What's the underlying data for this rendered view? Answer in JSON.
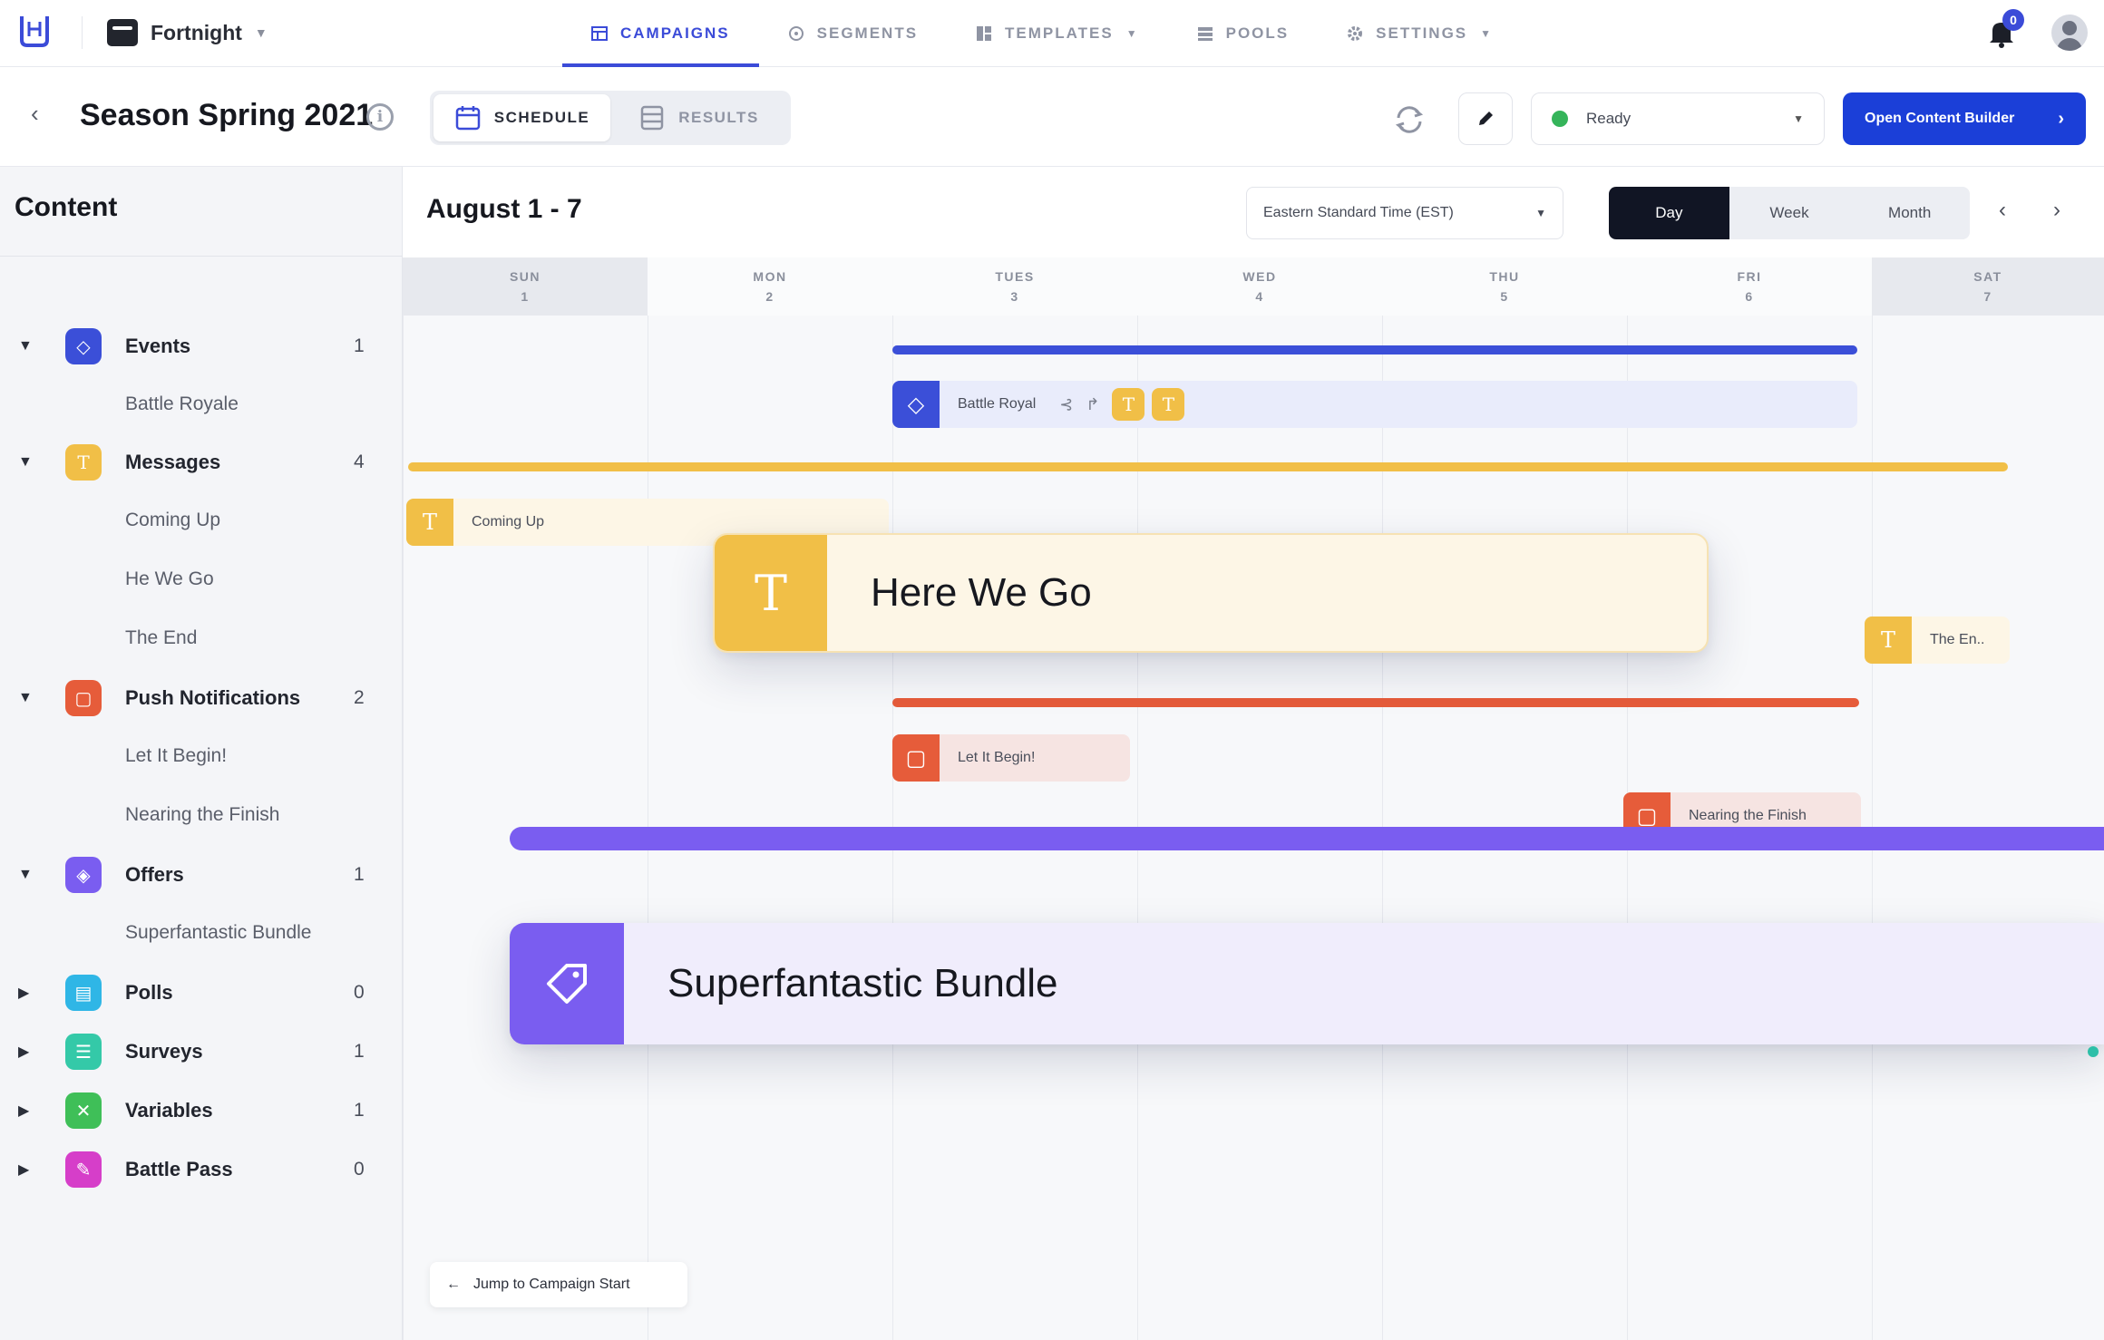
{
  "nav": {
    "project": "Fortnight",
    "tabs": [
      {
        "label": "CAMPAIGNS",
        "icon": "calendar-grid-icon"
      },
      {
        "label": "SEGMENTS",
        "icon": "target-icon"
      },
      {
        "label": "TEMPLATES",
        "icon": "template-icon"
      },
      {
        "label": "POOLS",
        "icon": "pool-icon"
      },
      {
        "label": "SETTINGS",
        "icon": "gear-icon"
      }
    ],
    "notifications": "0"
  },
  "header": {
    "title": "Season Spring 2021",
    "tabs": [
      "SCHEDULE",
      "RESULTS"
    ],
    "status": "Ready",
    "open_button": "Open Content Builder"
  },
  "sidebar": {
    "title": "Content",
    "categories": [
      {
        "label": "Events",
        "count": "1",
        "color": "#3b4fd8",
        "icon": "events-icon",
        "items": [
          "Battle Royale"
        ]
      },
      {
        "label": "Messages",
        "count": "4",
        "color": "#f1bf47",
        "icon": "message-icon",
        "items": [
          "Coming Up",
          "He We Go",
          "The End"
        ]
      },
      {
        "label": "Push Notifications",
        "count": "2",
        "color": "#e65c3a",
        "icon": "push-icon",
        "items": [
          "Let It Begin!",
          "Nearing the Finish"
        ]
      },
      {
        "label": "Offers",
        "count": "1",
        "color": "#7a5df0",
        "icon": "tag-icon",
        "items": [
          "Superfantastic Bundle"
        ]
      },
      {
        "label": "Polls",
        "count": "0",
        "color": "#2fb6e6",
        "icon": "poll-icon",
        "items": []
      },
      {
        "label": "Surveys",
        "count": "1",
        "color": "#34c9a8",
        "icon": "survey-icon",
        "items": []
      },
      {
        "label": "Variables",
        "count": "1",
        "color": "#3fbf58",
        "icon": "variable-icon",
        "items": []
      },
      {
        "label": "Battle Pass",
        "count": "0",
        "color": "#d63ec9",
        "icon": "battlepass-icon",
        "items": []
      }
    ]
  },
  "calendar": {
    "range": "August 1 - 7",
    "timezone": "Eastern Standard Time (EST)",
    "views": [
      "Day",
      "Week",
      "Month"
    ],
    "active_view": "Day",
    "days": [
      {
        "name": "SUN",
        "num": "1"
      },
      {
        "name": "MON",
        "num": "2"
      },
      {
        "name": "TUES",
        "num": "3"
      },
      {
        "name": "WED",
        "num": "4"
      },
      {
        "name": "THU",
        "num": "5"
      },
      {
        "name": "FRI",
        "num": "6"
      },
      {
        "name": "SAT",
        "num": "7"
      }
    ],
    "events": {
      "battle_royal": "Battle Royal",
      "coming_up": "Coming Up",
      "here_we_go": "Here We Go",
      "the_end": "The En..",
      "let_it_begin": "Let It Begin!",
      "nearing_finish": "Nearing the Finish",
      "bundle": "Superfantastic Bundle"
    },
    "jump": "Jump to Campaign Start"
  },
  "colors": {
    "accent": "#1b3fd8",
    "events": "#3b4fd8",
    "messages": "#f1bf47",
    "push": "#e65c3a",
    "offers": "#7a5df0",
    "variables": "#3fbf58"
  }
}
